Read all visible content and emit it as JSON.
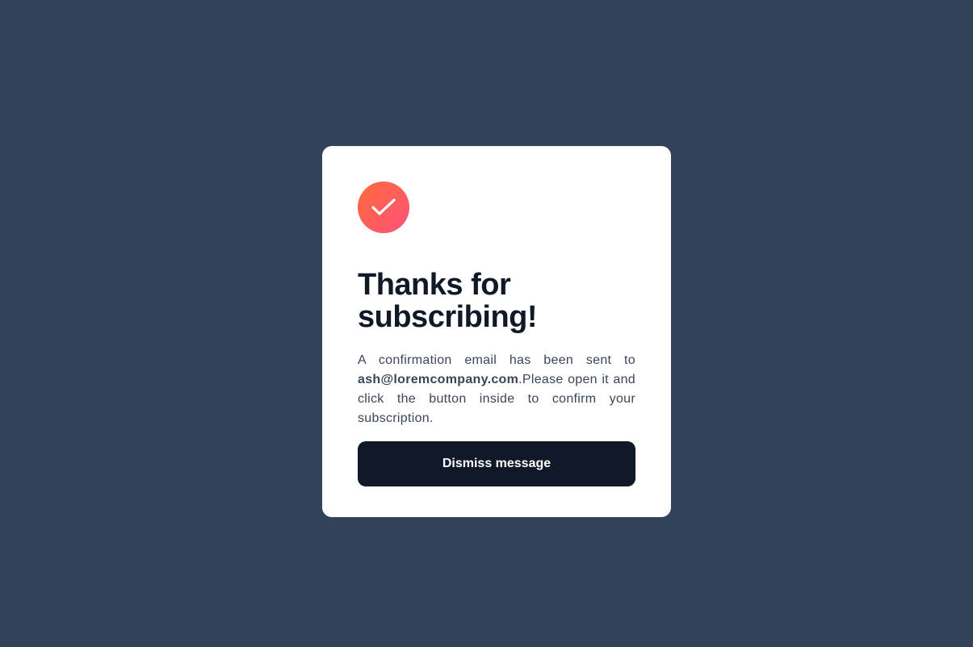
{
  "colors": {
    "page_background": "#334259",
    "card_background": "#ffffff",
    "icon_gradient_start": "#ff6a3a",
    "icon_gradient_end": "#ff527b",
    "button_background": "#111827",
    "button_text": "#ffffff",
    "title_text": "#111827",
    "body_text": "#3a4558"
  },
  "card": {
    "icon": "check-circle-icon",
    "title": "Thanks for subscribing!",
    "message_prefix": "A confirmation email has been sent to ",
    "email": "ash@loremcompany.com",
    "message_suffix": ".Please open it and click the button inside to confirm your subscription.",
    "dismiss_label": "Dismiss message"
  }
}
